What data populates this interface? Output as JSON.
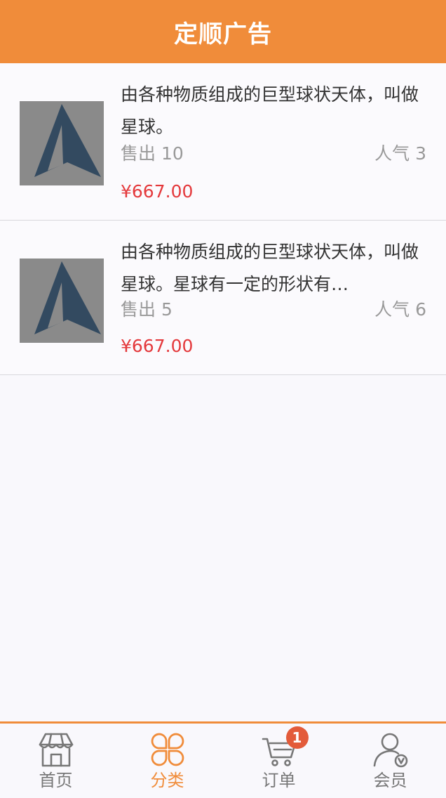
{
  "header": {
    "title": "定顺广告"
  },
  "products": [
    {
      "title": "由各种物质组成的巨型球状天体，叫做星球。",
      "sold": "售出 10",
      "popularity": "人气 3",
      "price": "¥667.00"
    },
    {
      "title": "由各种物质组成的巨型球状天体，叫做星球。星球有一定的形状有…",
      "sold": "售出 5",
      "popularity": "人气 6",
      "price": "¥667.00"
    }
  ],
  "tabbar": {
    "items": [
      {
        "label": "首页",
        "icon": "storefront-icon"
      },
      {
        "label": "分类",
        "icon": "category-grid-icon"
      },
      {
        "label": "订单",
        "icon": "cart-icon",
        "badge": "1"
      },
      {
        "label": "会员",
        "icon": "member-icon"
      }
    ],
    "active_index": 1,
    "accent_color": "#f08c3a"
  }
}
